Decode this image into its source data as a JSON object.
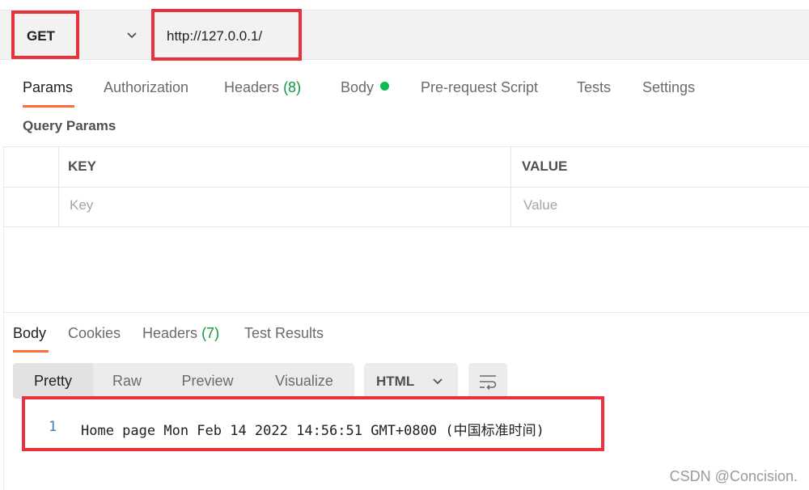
{
  "request": {
    "method": "GET",
    "url": "http://127.0.0.1/"
  },
  "request_tabs": [
    {
      "label": "Params",
      "active": true
    },
    {
      "label": "Authorization"
    },
    {
      "label": "Headers",
      "count": "(8)"
    },
    {
      "label": "Body",
      "indicator": "green-dot"
    },
    {
      "label": "Pre-request Script"
    },
    {
      "label": "Tests"
    },
    {
      "label": "Settings"
    }
  ],
  "query_params": {
    "title": "Query Params",
    "columns": [
      "KEY",
      "VALUE"
    ],
    "placeholders": {
      "key": "Key",
      "value": "Value"
    }
  },
  "response_tabs": [
    {
      "label": "Body",
      "active": true
    },
    {
      "label": "Cookies"
    },
    {
      "label": "Headers",
      "count": "(7)"
    },
    {
      "label": "Test Results"
    }
  ],
  "view_modes": [
    {
      "label": "Pretty",
      "active": true
    },
    {
      "label": "Raw"
    },
    {
      "label": "Preview"
    },
    {
      "label": "Visualize"
    }
  ],
  "format": {
    "selected": "HTML"
  },
  "response_body": {
    "lines": [
      {
        "number": "1",
        "text": "Home page Mon Feb 14 2022 14:56:51 GMT+0800 (中国标准时间)"
      }
    ]
  },
  "watermark": "CSDN @Concision.",
  "colors": {
    "accent": "#ff6c37",
    "highlight_box": "#e8323c",
    "count_green": "#0c9a3c",
    "body_dot": "#0cbb52"
  },
  "icons": {
    "method_dropdown": "chevron-down-icon",
    "format_dropdown": "chevron-down-icon",
    "wrap": "wrap-lines-icon"
  }
}
